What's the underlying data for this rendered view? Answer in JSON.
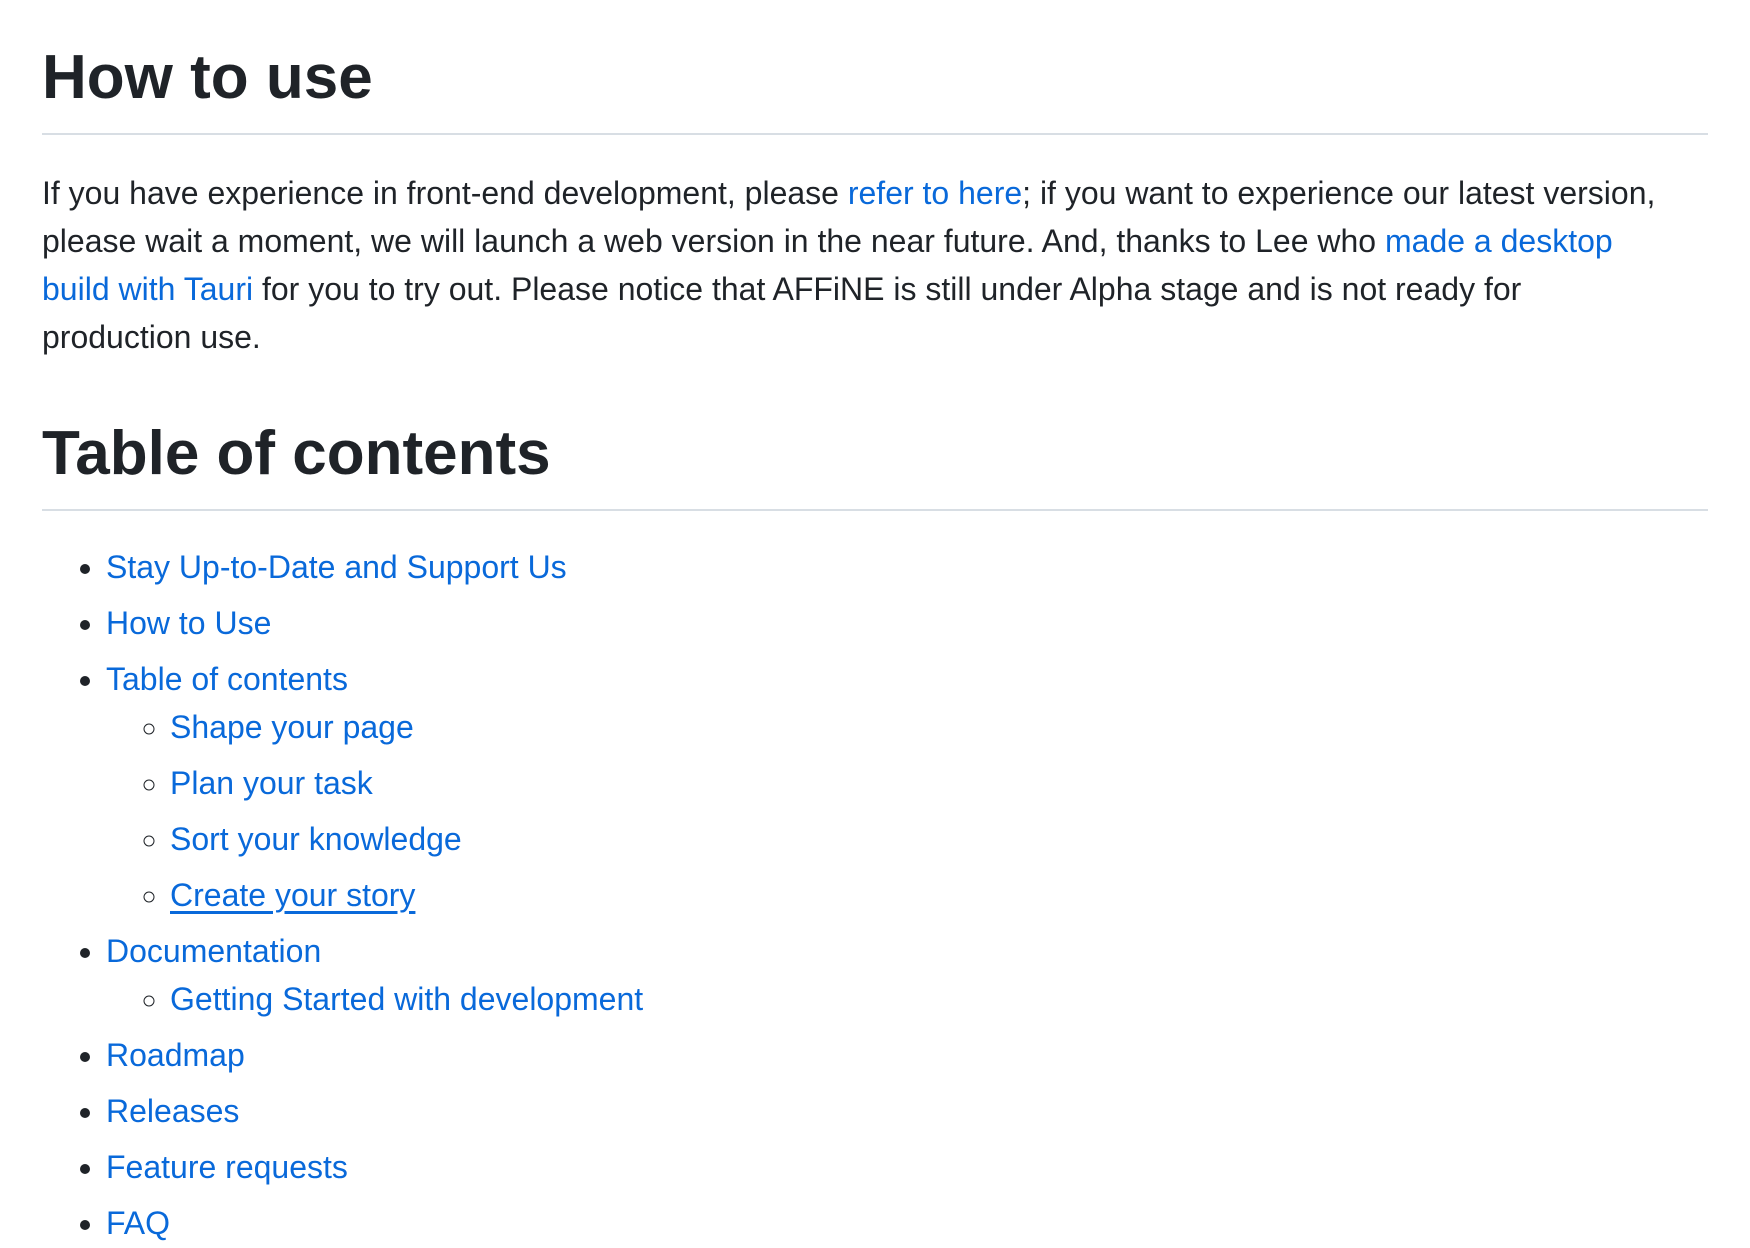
{
  "colors": {
    "text": "#1f2328",
    "link": "#0969da",
    "divider": "#d8dee4",
    "background": "#ffffff"
  },
  "how_to_use": {
    "heading": "How to use",
    "paragraph": {
      "text_1": "If you have experience in front-end development, please ",
      "link_refer": "refer to here",
      "text_2": "; if you want to experience our latest version,",
      "text_3": "please wait a moment, we will launch a web version in the near future. And, thanks to Lee who ",
      "link_desktop_build_part_1": "made a desktop",
      "link_desktop_build_part_2": "build with Tauri",
      "text_4": " for you to try out. Please notice that AFFiNE is still under Alpha stage and is not ready for",
      "text_5": "production use."
    }
  },
  "table_of_contents": {
    "heading": "Table of contents",
    "items": [
      {
        "label": "Stay Up-to-Date and Support Us"
      },
      {
        "label": "How to Use"
      },
      {
        "label": "Table of contents",
        "children": [
          {
            "label": "Shape your page"
          },
          {
            "label": "Plan your task"
          },
          {
            "label": "Sort your knowledge"
          },
          {
            "label": "Create your story",
            "hovered": true
          }
        ]
      },
      {
        "label": "Documentation",
        "children": [
          {
            "label": "Getting Started with development"
          }
        ]
      },
      {
        "label": "Roadmap"
      },
      {
        "label": "Releases"
      },
      {
        "label": "Feature requests"
      },
      {
        "label": "FAQ"
      }
    ]
  }
}
